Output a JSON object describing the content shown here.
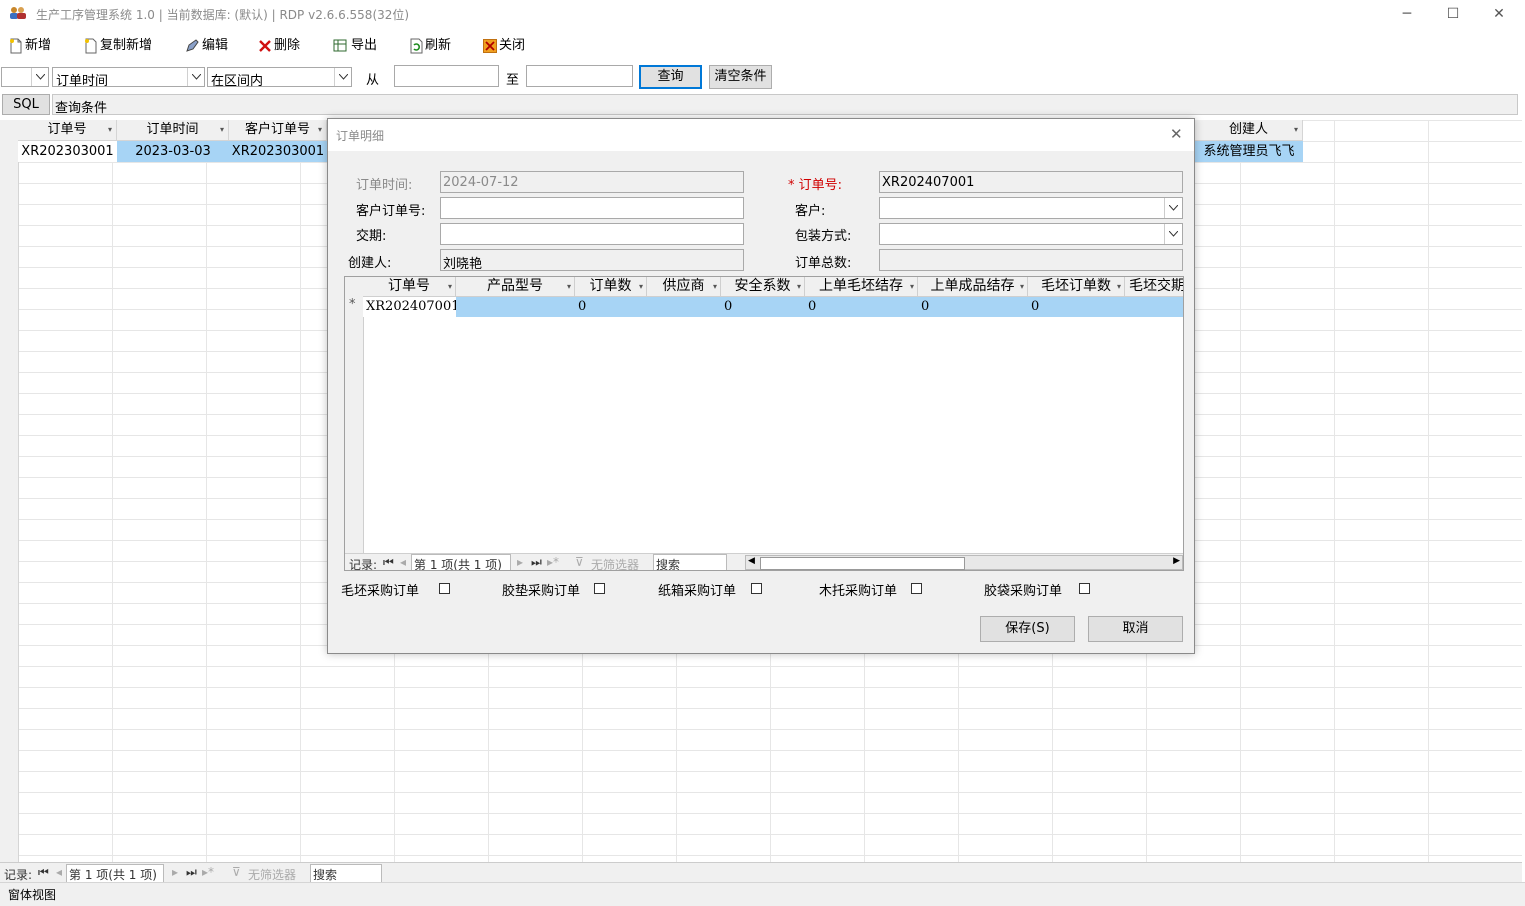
{
  "window": {
    "title": "生产工序管理系统 1.0 | 当前数据库: (默认) | RDP v2.6.6.558(32位)",
    "minimize": "─",
    "maximize": "☐",
    "close": "✕"
  },
  "toolbar": {
    "new": "新增",
    "copy_new": "复制新增",
    "edit": "编辑",
    "delete": "删除",
    "export": "导出",
    "refresh": "刷新",
    "close": "关闭"
  },
  "filter": {
    "field_select": "订单时间",
    "op_select": "在区间内",
    "from_label": "从",
    "to_label": "至",
    "query_btn": "查询",
    "clear_btn": "清空条件",
    "sql_btn": "SQL",
    "condition_text": "查询条件"
  },
  "main_grid": {
    "columns": [
      "订单号",
      "订单时间",
      "客户订单号",
      "创建人"
    ],
    "row": {
      "order_no": "XR202303001",
      "order_time": "2023-03-03",
      "customer_order": "XR202303001",
      "creator": "系统管理员飞飞"
    }
  },
  "main_nav": {
    "record_label": "记录:",
    "page": "第 1 项(共 1 项)",
    "no_filter": "无筛选器",
    "search": "搜索"
  },
  "statusbar": {
    "text": "窗体视图"
  },
  "dialog": {
    "title": "订单明细",
    "fields": {
      "order_time_label": "订单时间:",
      "order_time_value": "2024-07-12",
      "order_no_label": "* 订单号:",
      "order_no_value": "XR202407001",
      "customer_order_label": "客户订单号:",
      "customer_label": "客户:",
      "delivery_label": "交期:",
      "packaging_label": "包装方式:",
      "creator_label": "创建人:",
      "creator_value": "刘晓艳",
      "total_label": "订单总数:"
    },
    "subgrid": {
      "columns": [
        "订单号",
        "产品型号",
        "订单数",
        "供应商",
        "安全系数",
        "上单毛坯结存",
        "上单成品结存",
        "毛坯订单数",
        "毛坯交期"
      ],
      "row_marker": "*",
      "row": [
        "XR202407001",
        "",
        "0",
        "",
        "0",
        "0",
        "0",
        "0",
        ""
      ]
    },
    "sub_nav": {
      "record_label": "记录:",
      "page": "第 1 项(共 1 项)",
      "no_filter": "无筛选器",
      "search": "搜索"
    },
    "checkboxes": [
      "毛坯采购订单",
      "胶垫采购订单",
      "纸箱采购订单",
      "木托采购订单",
      "胶袋采购订单"
    ],
    "save_btn": "保存(S)",
    "cancel_btn": "取消"
  }
}
